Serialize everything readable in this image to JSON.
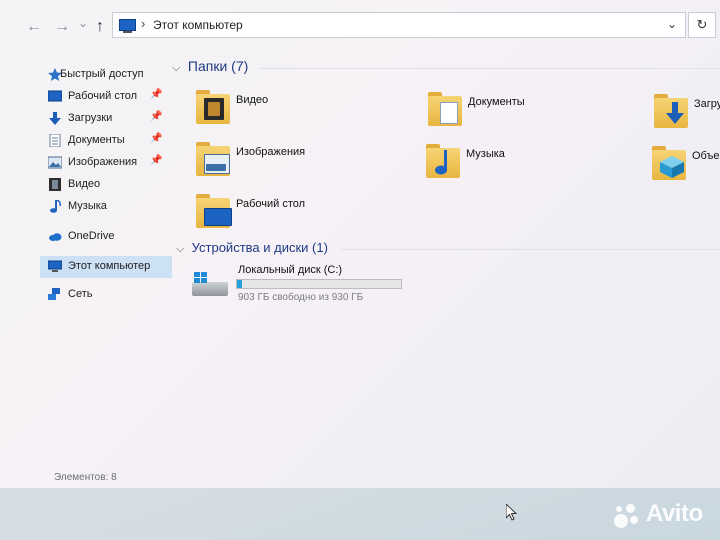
{
  "address_bar": {
    "path": "Этот компьютер",
    "separator": "›",
    "back_icon": "←",
    "forward_icon": "→",
    "recent_icon": "⌄",
    "up_icon": "↑",
    "dropdown_icon": "⌄",
    "refresh_icon": "↻"
  },
  "sidebar": {
    "quick_access": "Быстрый доступ",
    "items": [
      {
        "label": "Рабочий стол",
        "pinned": true
      },
      {
        "label": "Загрузки",
        "pinned": true
      },
      {
        "label": "Документы",
        "pinned": true
      },
      {
        "label": "Изображения",
        "pinned": true
      },
      {
        "label": "Видео",
        "pinned": false
      },
      {
        "label": "Музыка",
        "pinned": false
      }
    ],
    "onedrive": "OneDrive",
    "this_pc": "Этот компьютер",
    "network": "Сеть",
    "pin_icon": "📌"
  },
  "folders_section": {
    "title": "Папки (7)",
    "chevron": "⌵",
    "folders": [
      {
        "label": "Видео",
        "icon": "video-folder-icon"
      },
      {
        "label": "Документы",
        "icon": "documents-folder-icon"
      },
      {
        "label": "Загру",
        "icon": "downloads-folder-icon"
      },
      {
        "label": "Изображения",
        "icon": "pictures-folder-icon"
      },
      {
        "label": "Музыка",
        "icon": "music-folder-icon"
      },
      {
        "label": "Объем",
        "icon": "3d-objects-folder-icon"
      },
      {
        "label": "Рабочий стол",
        "icon": "desktop-folder-icon"
      }
    ]
  },
  "drives_section": {
    "title": "Устройства и диски (1)",
    "chevron": "⌵",
    "drive": {
      "name": "Локальный диск (C:)",
      "free_text": "903 ГБ свободно из 930 ГБ",
      "used_fraction": 0.029
    }
  },
  "status_bar": {
    "items": "Элементов: 8"
  },
  "watermark": {
    "text": "Avito"
  },
  "colors": {
    "accent": "#1f3a84",
    "selection": "#cde1f5",
    "drive_fill": "#26a0da"
  }
}
